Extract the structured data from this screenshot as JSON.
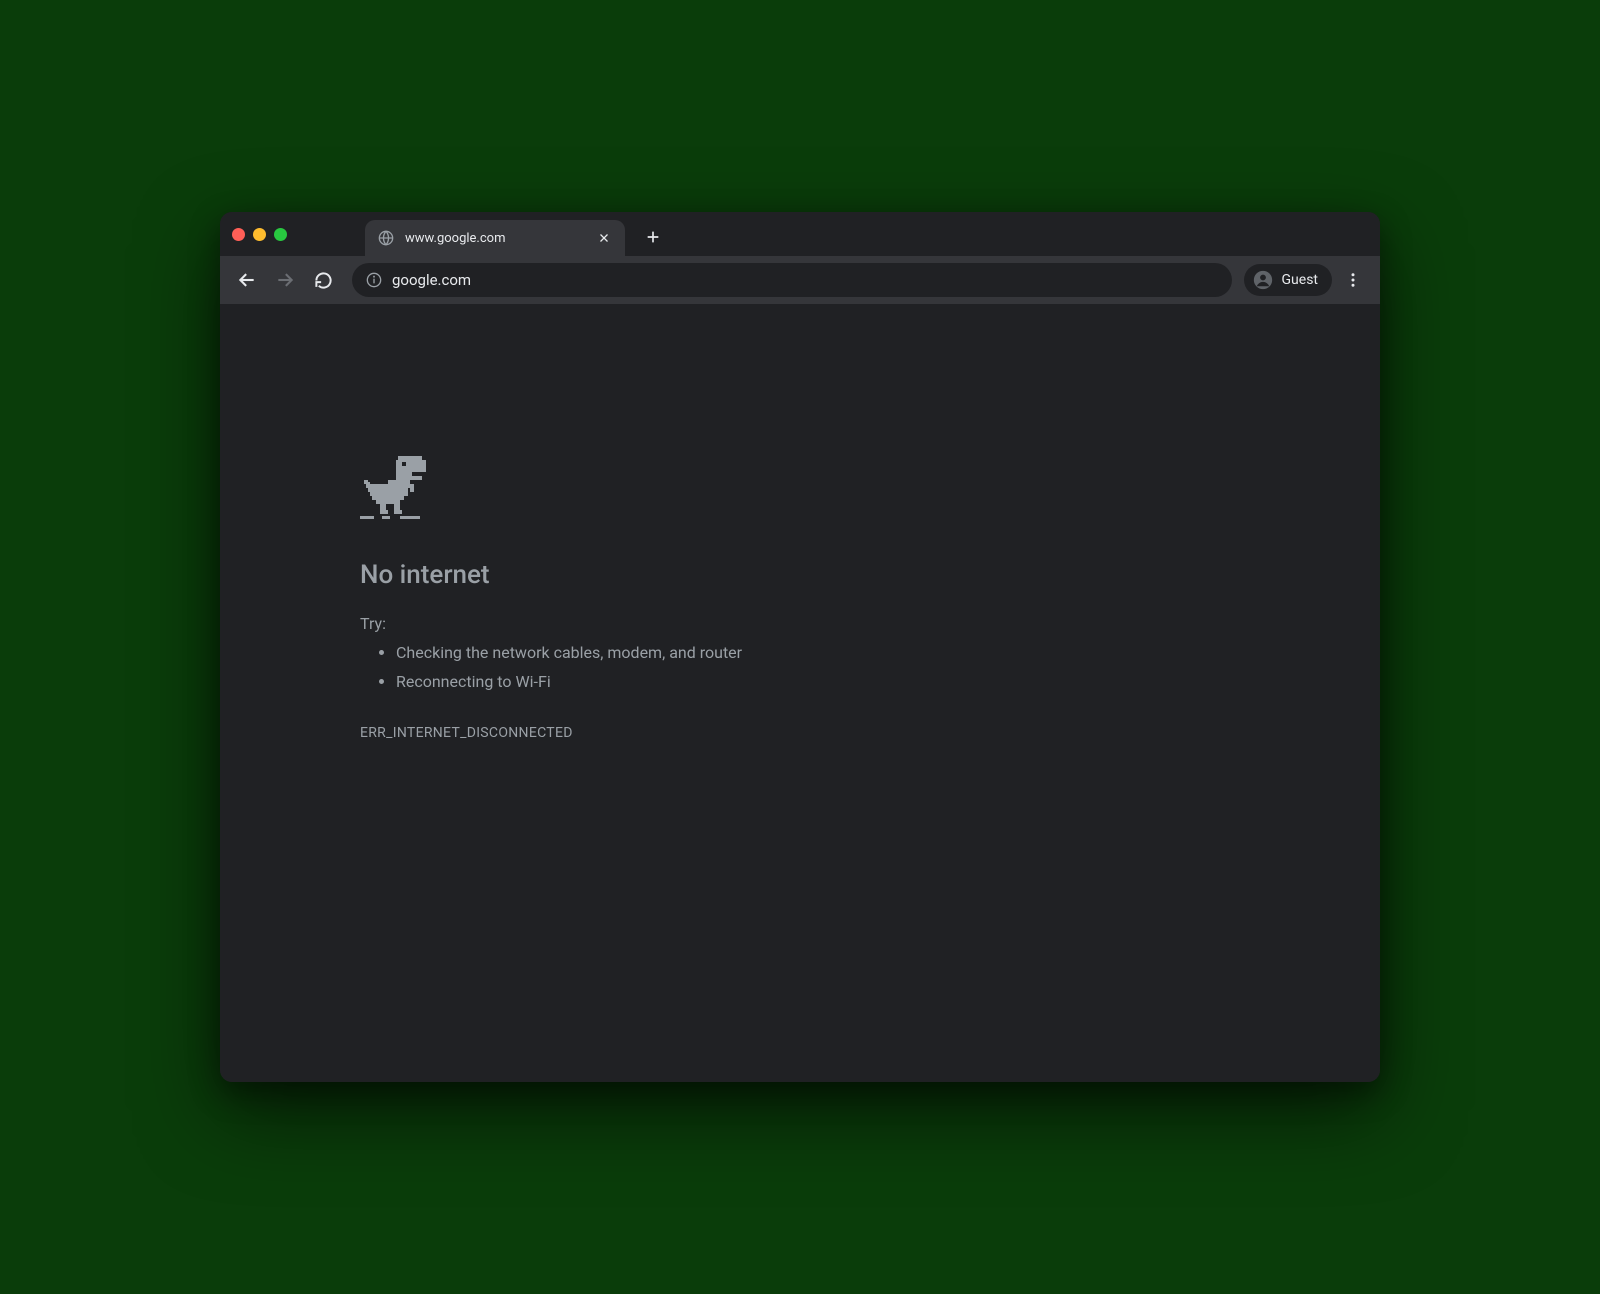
{
  "tab": {
    "title": "www.google.com"
  },
  "omnibox": {
    "url": "google.com"
  },
  "profile": {
    "label": "Guest"
  },
  "error": {
    "title": "No internet",
    "tryLabel": "Try:",
    "suggestions": [
      "Checking the network cables, modem, and router",
      "Reconnecting to Wi-Fi"
    ],
    "code": "ERR_INTERNET_DISCONNECTED"
  }
}
